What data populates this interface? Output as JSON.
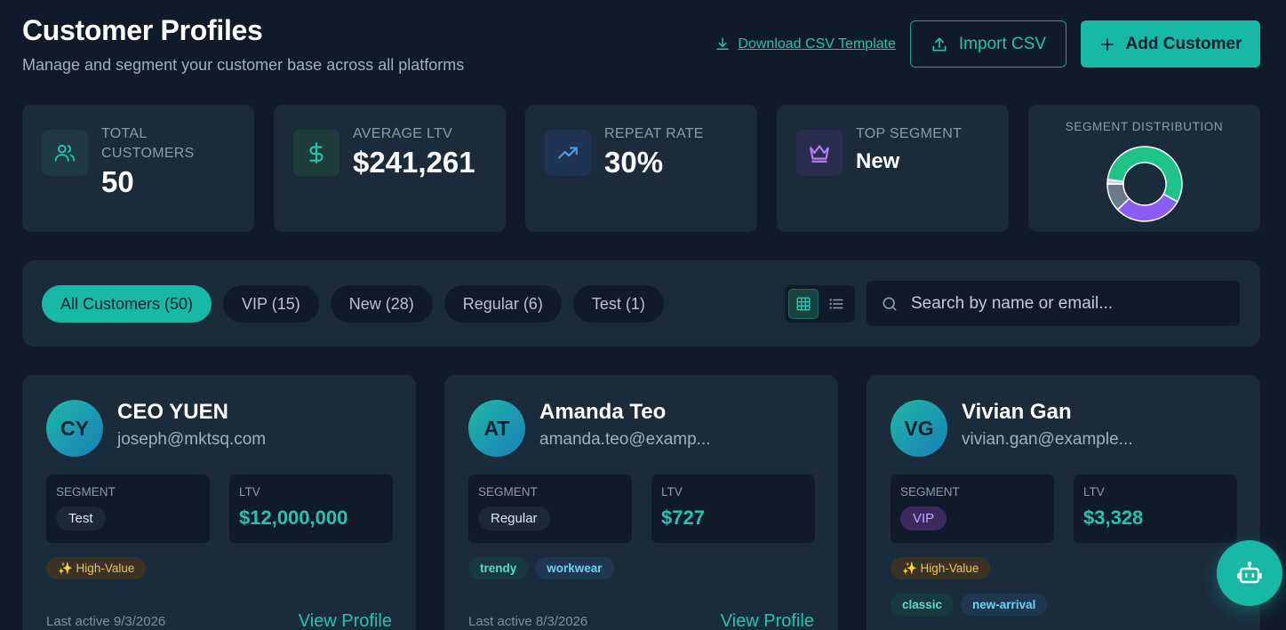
{
  "header": {
    "title": "Customer Profiles",
    "subtitle": "Manage and segment your customer base across all platforms",
    "download_label": "Download CSV Template",
    "import_label": "Import CSV",
    "add_label": "Add Customer"
  },
  "stats": {
    "total": {
      "label": "Total Customers",
      "value": "50",
      "icon": "users-icon"
    },
    "ltv": {
      "label": "Average LTV",
      "value": "$241,261",
      "icon": "dollar-icon"
    },
    "repeat": {
      "label": "Repeat Rate",
      "value": "30%",
      "icon": "trending-up-icon"
    },
    "top": {
      "label": "Top Segment",
      "value": "New",
      "icon": "crown-icon"
    },
    "distribution": {
      "label": "Segment Distribution"
    }
  },
  "chart_data": {
    "type": "pie",
    "categories": [
      "New",
      "VIP",
      "Regular",
      "Test"
    ],
    "values": [
      28,
      15,
      6,
      1
    ],
    "colors": [
      "#1fc38a",
      "#8b5cf6",
      "#6b7a89",
      "#d0d6dc"
    ]
  },
  "filters": {
    "pills": [
      {
        "label": "All Customers (50)",
        "active": true
      },
      {
        "label": "VIP (15)",
        "active": false
      },
      {
        "label": "New (28)",
        "active": false
      },
      {
        "label": "Regular (6)",
        "active": false
      },
      {
        "label": "Test (1)",
        "active": false
      }
    ],
    "search_placeholder": "Search by name or email..."
  },
  "cards": [
    {
      "initials": "CY",
      "name": "CEO YUEN",
      "email": "joseph@mktsq.com",
      "segment_label": "Segment",
      "segment": "Test",
      "ltv_label": "LTV",
      "ltv": "$12,000,000",
      "tag1": "✨ High-Value",
      "tag2": "",
      "tag3": "",
      "last_active": "Last active 9/3/2026",
      "view_label": "View Profile"
    },
    {
      "initials": "AT",
      "name": "Amanda Teo",
      "email": "amanda.teo@examp...",
      "segment_label": "Segment",
      "segment": "Regular",
      "ltv_label": "LTV",
      "ltv": "$727",
      "tag1": "trendy",
      "tag2": "workwear",
      "tag3": "",
      "last_active": "Last active 8/3/2026",
      "view_label": "View Profile"
    },
    {
      "initials": "VG",
      "name": "Vivian Gan",
      "email": "vivian.gan@example...",
      "segment_label": "Segment",
      "segment": "VIP",
      "ltv_label": "LTV",
      "ltv": "$3,328",
      "tag1": "✨ High-Value",
      "tag2": "classic",
      "tag3": "new-arrival",
      "last_active": "",
      "view_label": ""
    }
  ]
}
